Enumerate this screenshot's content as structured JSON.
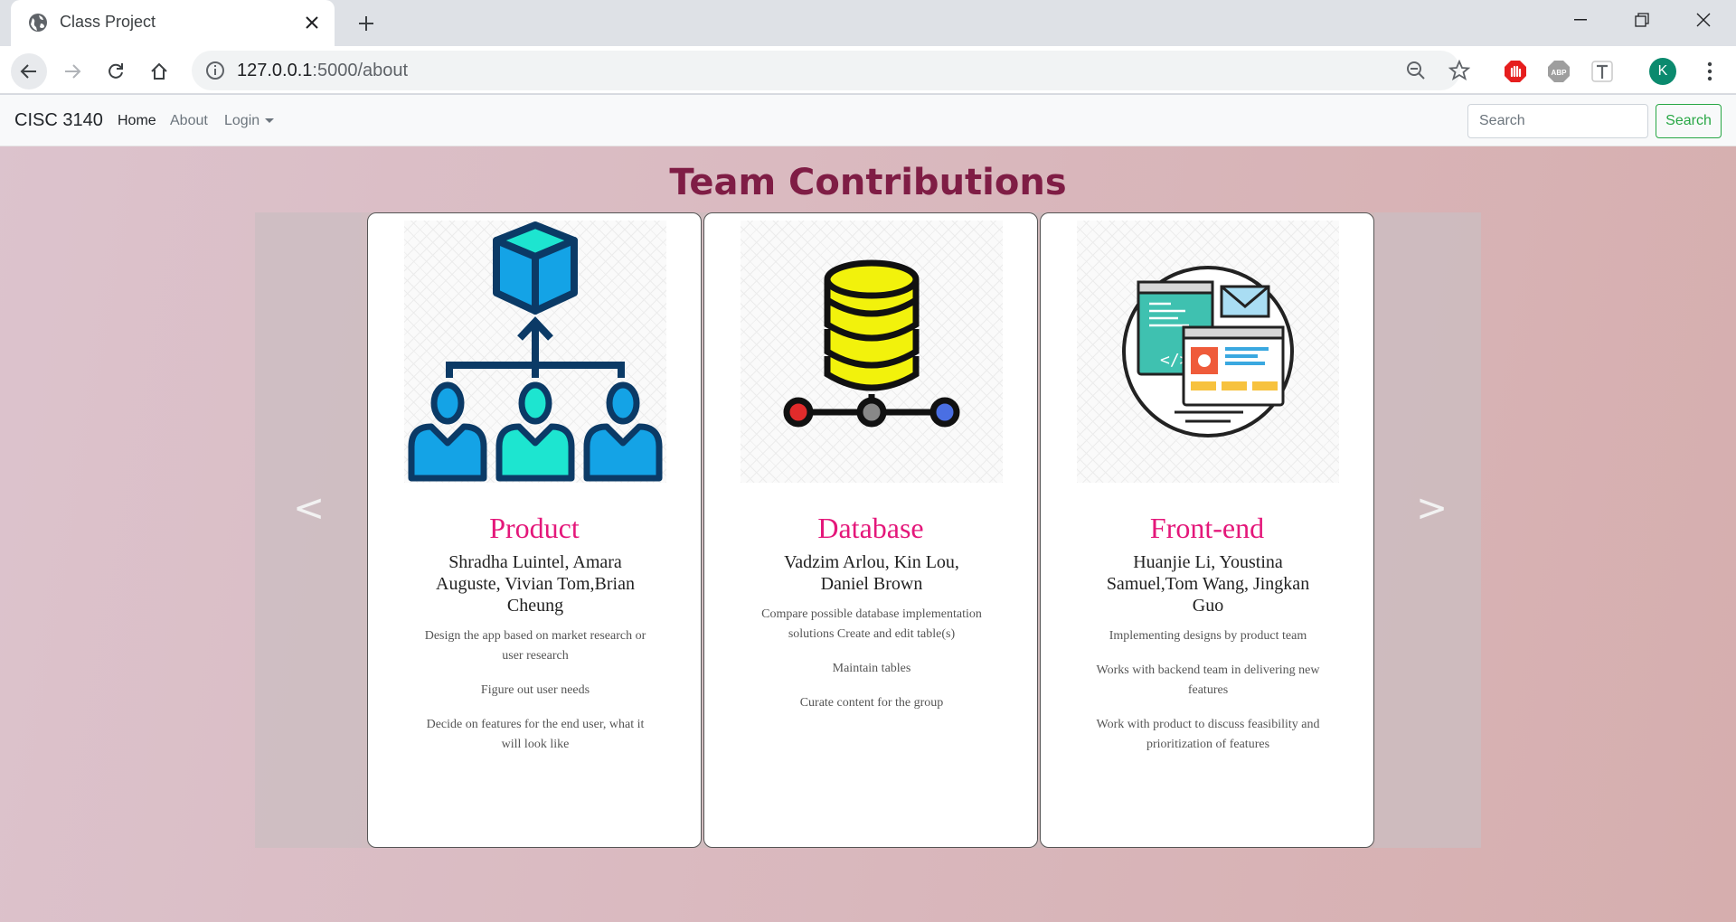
{
  "browser": {
    "tab_title": "Class Project",
    "url_host": "127.0.0.1",
    "url_path": ":5000/about",
    "profile_initial": "K",
    "extensions": [
      "adblock-stop-icon",
      "abp-icon",
      "text-t-icon"
    ]
  },
  "navbar": {
    "brand": "CISC 3140",
    "links": [
      "Home",
      "About",
      "Login"
    ],
    "search_placeholder": "Search",
    "search_button": "Search"
  },
  "page": {
    "heading": "Team Contributions",
    "prev_arrow": "<",
    "next_arrow": ">"
  },
  "cards": [
    {
      "title": "Product",
      "icon": "team-hierarchy-icon",
      "members": "Shradha Luintel, Amara Auguste, Vivian Tom,Brian Cheung",
      "points": [
        "Design the app based on market research or user research",
        "Figure out user needs",
        "Decide on features for the end user, what it will look like"
      ]
    },
    {
      "title": "Database",
      "icon": "database-icon",
      "members": "Vadzim Arlou, Kin Lou, Daniel Brown",
      "points": [
        "Compare possible database implementation solutions Create and edit table(s)",
        "Maintain tables",
        "Curate content for the group"
      ]
    },
    {
      "title": "Front-end",
      "icon": "web-design-icon",
      "members": "Huanjie Li, Youstina Samuel,Tom Wang, Jingkan Guo",
      "points": [
        "Implementing designs by product team",
        "Works with backend team in delivering new features",
        "Work with product to discuss feasibility and prioritization of features"
      ]
    }
  ]
}
